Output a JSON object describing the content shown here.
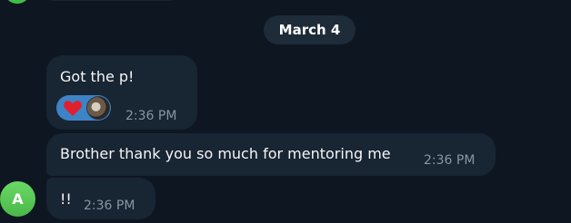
{
  "date_separator": "March 4",
  "messages": [
    {
      "text": "Got the p!",
      "time": "2:36 PM",
      "reactions": [
        {
          "emoji": "heart-icon",
          "color": "#e0202e"
        }
      ]
    },
    {
      "text": "Brother thank you so much for mentoring me",
      "time": "2:36 PM"
    },
    {
      "text": "!!",
      "time": "2:36 PM"
    }
  ],
  "sender": {
    "avatar_initial": "A",
    "avatar_color": "#49b84a"
  },
  "colors": {
    "background": "#0e1621",
    "bubble": "#182533",
    "reaction_pill": "#3d84c6",
    "timestamp": "#8696a4"
  }
}
